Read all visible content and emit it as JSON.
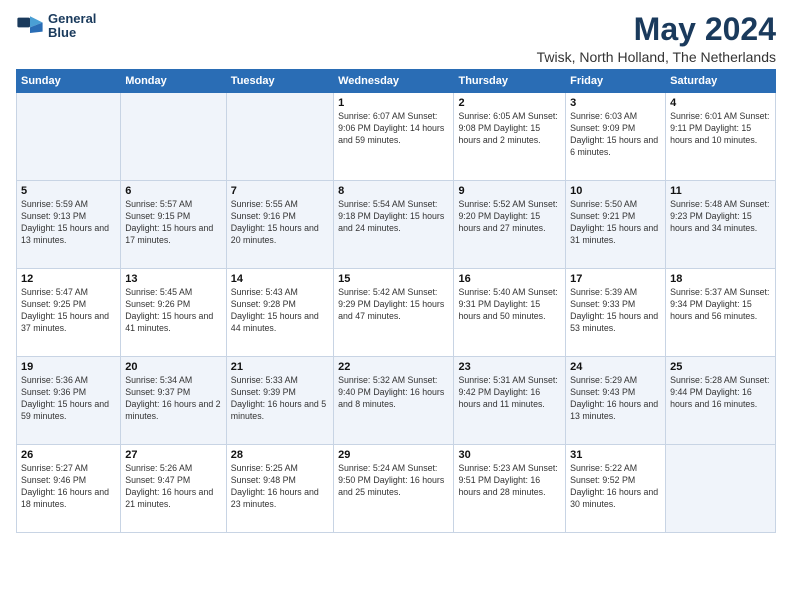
{
  "header": {
    "logo_line1": "General",
    "logo_line2": "Blue",
    "title": "May 2024",
    "subtitle": "Twisk, North Holland, The Netherlands"
  },
  "calendar": {
    "days_of_week": [
      "Sunday",
      "Monday",
      "Tuesday",
      "Wednesday",
      "Thursday",
      "Friday",
      "Saturday"
    ],
    "weeks": [
      [
        {
          "num": "",
          "detail": ""
        },
        {
          "num": "",
          "detail": ""
        },
        {
          "num": "",
          "detail": ""
        },
        {
          "num": "1",
          "detail": "Sunrise: 6:07 AM\nSunset: 9:06 PM\nDaylight: 14 hours\nand 59 minutes."
        },
        {
          "num": "2",
          "detail": "Sunrise: 6:05 AM\nSunset: 9:08 PM\nDaylight: 15 hours\nand 2 minutes."
        },
        {
          "num": "3",
          "detail": "Sunrise: 6:03 AM\nSunset: 9:09 PM\nDaylight: 15 hours\nand 6 minutes."
        },
        {
          "num": "4",
          "detail": "Sunrise: 6:01 AM\nSunset: 9:11 PM\nDaylight: 15 hours\nand 10 minutes."
        }
      ],
      [
        {
          "num": "5",
          "detail": "Sunrise: 5:59 AM\nSunset: 9:13 PM\nDaylight: 15 hours\nand 13 minutes."
        },
        {
          "num": "6",
          "detail": "Sunrise: 5:57 AM\nSunset: 9:15 PM\nDaylight: 15 hours\nand 17 minutes."
        },
        {
          "num": "7",
          "detail": "Sunrise: 5:55 AM\nSunset: 9:16 PM\nDaylight: 15 hours\nand 20 minutes."
        },
        {
          "num": "8",
          "detail": "Sunrise: 5:54 AM\nSunset: 9:18 PM\nDaylight: 15 hours\nand 24 minutes."
        },
        {
          "num": "9",
          "detail": "Sunrise: 5:52 AM\nSunset: 9:20 PM\nDaylight: 15 hours\nand 27 minutes."
        },
        {
          "num": "10",
          "detail": "Sunrise: 5:50 AM\nSunset: 9:21 PM\nDaylight: 15 hours\nand 31 minutes."
        },
        {
          "num": "11",
          "detail": "Sunrise: 5:48 AM\nSunset: 9:23 PM\nDaylight: 15 hours\nand 34 minutes."
        }
      ],
      [
        {
          "num": "12",
          "detail": "Sunrise: 5:47 AM\nSunset: 9:25 PM\nDaylight: 15 hours\nand 37 minutes."
        },
        {
          "num": "13",
          "detail": "Sunrise: 5:45 AM\nSunset: 9:26 PM\nDaylight: 15 hours\nand 41 minutes."
        },
        {
          "num": "14",
          "detail": "Sunrise: 5:43 AM\nSunset: 9:28 PM\nDaylight: 15 hours\nand 44 minutes."
        },
        {
          "num": "15",
          "detail": "Sunrise: 5:42 AM\nSunset: 9:29 PM\nDaylight: 15 hours\nand 47 minutes."
        },
        {
          "num": "16",
          "detail": "Sunrise: 5:40 AM\nSunset: 9:31 PM\nDaylight: 15 hours\nand 50 minutes."
        },
        {
          "num": "17",
          "detail": "Sunrise: 5:39 AM\nSunset: 9:33 PM\nDaylight: 15 hours\nand 53 minutes."
        },
        {
          "num": "18",
          "detail": "Sunrise: 5:37 AM\nSunset: 9:34 PM\nDaylight: 15 hours\nand 56 minutes."
        }
      ],
      [
        {
          "num": "19",
          "detail": "Sunrise: 5:36 AM\nSunset: 9:36 PM\nDaylight: 15 hours\nand 59 minutes."
        },
        {
          "num": "20",
          "detail": "Sunrise: 5:34 AM\nSunset: 9:37 PM\nDaylight: 16 hours\nand 2 minutes."
        },
        {
          "num": "21",
          "detail": "Sunrise: 5:33 AM\nSunset: 9:39 PM\nDaylight: 16 hours\nand 5 minutes."
        },
        {
          "num": "22",
          "detail": "Sunrise: 5:32 AM\nSunset: 9:40 PM\nDaylight: 16 hours\nand 8 minutes."
        },
        {
          "num": "23",
          "detail": "Sunrise: 5:31 AM\nSunset: 9:42 PM\nDaylight: 16 hours\nand 11 minutes."
        },
        {
          "num": "24",
          "detail": "Sunrise: 5:29 AM\nSunset: 9:43 PM\nDaylight: 16 hours\nand 13 minutes."
        },
        {
          "num": "25",
          "detail": "Sunrise: 5:28 AM\nSunset: 9:44 PM\nDaylight: 16 hours\nand 16 minutes."
        }
      ],
      [
        {
          "num": "26",
          "detail": "Sunrise: 5:27 AM\nSunset: 9:46 PM\nDaylight: 16 hours\nand 18 minutes."
        },
        {
          "num": "27",
          "detail": "Sunrise: 5:26 AM\nSunset: 9:47 PM\nDaylight: 16 hours\nand 21 minutes."
        },
        {
          "num": "28",
          "detail": "Sunrise: 5:25 AM\nSunset: 9:48 PM\nDaylight: 16 hours\nand 23 minutes."
        },
        {
          "num": "29",
          "detail": "Sunrise: 5:24 AM\nSunset: 9:50 PM\nDaylight: 16 hours\nand 25 minutes."
        },
        {
          "num": "30",
          "detail": "Sunrise: 5:23 AM\nSunset: 9:51 PM\nDaylight: 16 hours\nand 28 minutes."
        },
        {
          "num": "31",
          "detail": "Sunrise: 5:22 AM\nSunset: 9:52 PM\nDaylight: 16 hours\nand 30 minutes."
        },
        {
          "num": "",
          "detail": ""
        }
      ]
    ]
  }
}
